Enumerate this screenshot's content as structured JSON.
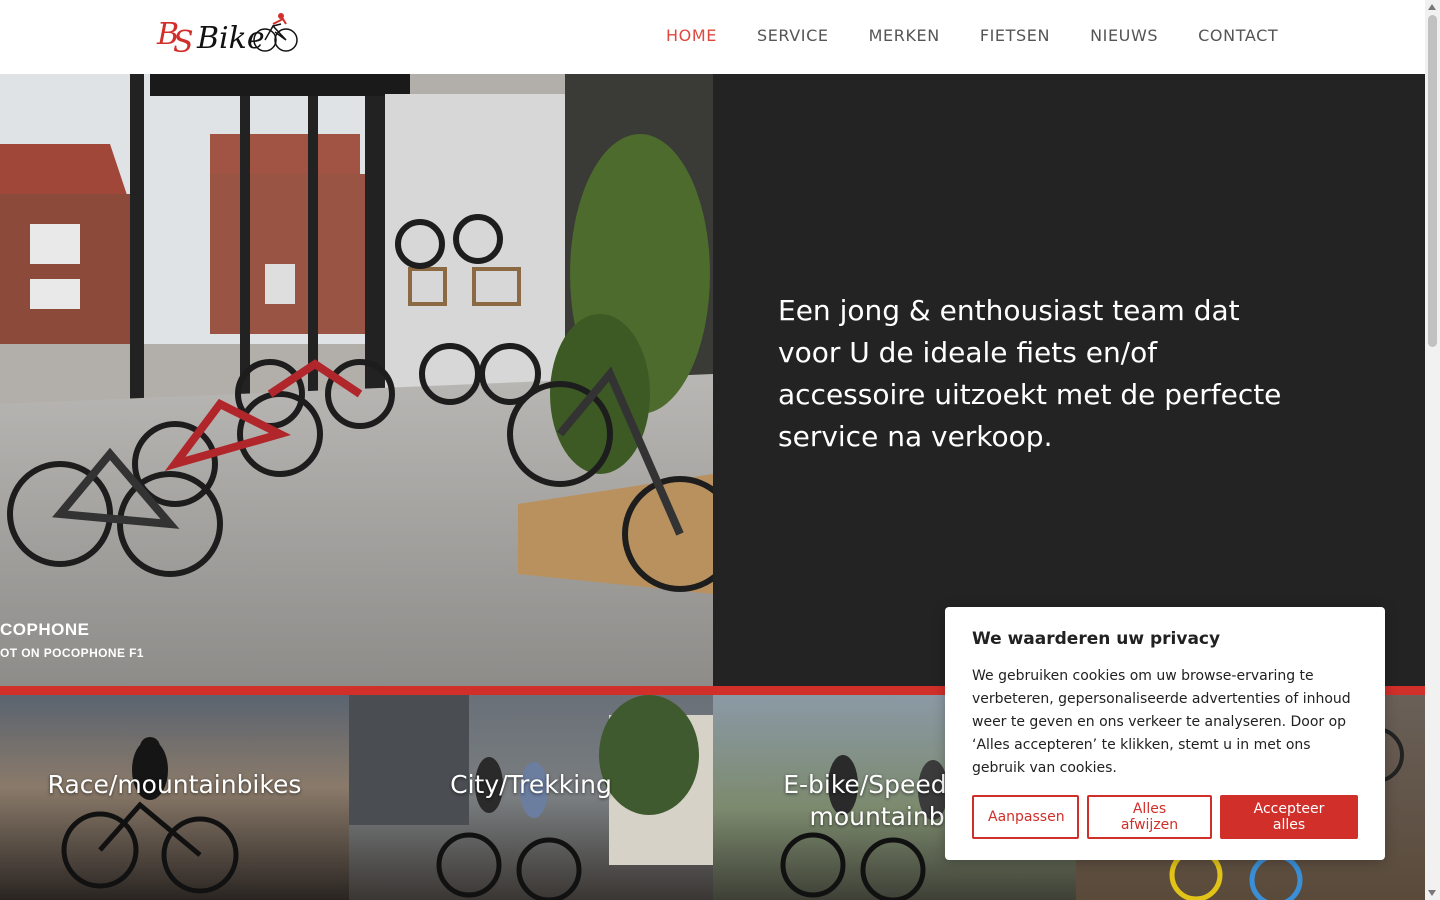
{
  "header": {
    "logo_alt": "BS Bike",
    "nav": [
      {
        "label": "HOME",
        "active": true
      },
      {
        "label": "SERVICE",
        "active": false
      },
      {
        "label": "MERKEN",
        "active": false
      },
      {
        "label": "FIETSEN",
        "active": false
      },
      {
        "label": "NIEUWS",
        "active": false
      },
      {
        "label": "CONTACT",
        "active": false
      }
    ]
  },
  "hero": {
    "photo_caption_line1": "COPHONE",
    "photo_caption_line2": "OT ON POCOPHONE F1",
    "text": "Een jong & enthousiast team dat voor U de ideale fiets en/of accessoire uitzoekt met de perfecte service na verkoop."
  },
  "categories": [
    {
      "title": "Race/mountainbikes"
    },
    {
      "title": "City/Trekking"
    },
    {
      "title": "E-bike/Speedbike/ mountainbike"
    },
    {
      "title": ""
    }
  ],
  "cookie_banner": {
    "title": "We waarderen uw privacy",
    "body": "We gebruiken cookies om uw browse-ervaring te verbeteren, gepersonaliseerde advertenties of inhoud weer te geven en ons verkeer te analyseren. Door op ‘Alles accepteren’ te klikken, stemt u in met ons gebruik van cookies.",
    "btn_customize": "Aanpassen",
    "btn_reject": "Alles afwijzen",
    "btn_accept": "Accepteer alles"
  },
  "colors": {
    "accent": "#d12f2a",
    "nav_active": "#e0483e",
    "hero_panel": "#232323"
  }
}
